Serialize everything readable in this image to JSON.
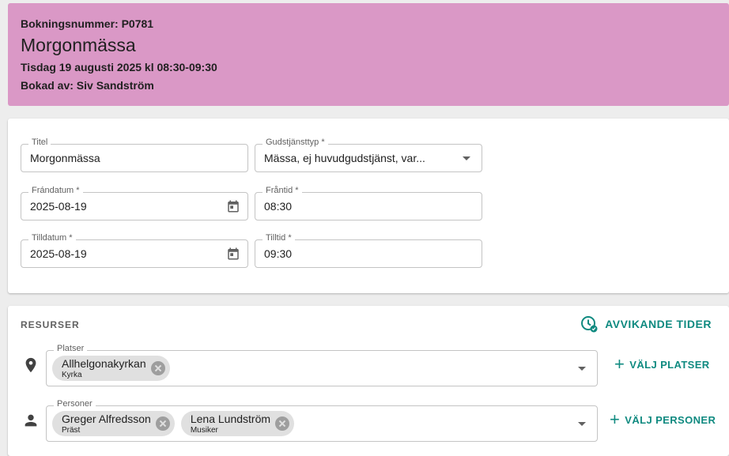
{
  "header": {
    "booking_number": "Bokningsnummer: P0781",
    "title": "Morgonmässa",
    "date": "Tisdag 19 augusti 2025 kl 08:30-09:30",
    "booked_by": "Bokad av: Siv Sandström",
    "background_color": "#da98c6"
  },
  "form": {
    "title": {
      "label": "Titel",
      "value": "Morgonmässa"
    },
    "service_type": {
      "label": "Gudstjänsttyp *",
      "value": "Mässa, ej huvudgudstjänst, var..."
    },
    "from_date": {
      "label": "Frándatum *",
      "value": "2025-08-19"
    },
    "from_time": {
      "label": "Fråntid *",
      "value": "08:30"
    },
    "to_date": {
      "label": "Tilldatum *",
      "value": "2025-08-19"
    },
    "to_time": {
      "label": "Tilltid *",
      "value": "09:30"
    }
  },
  "resources": {
    "heading": "RESURSER",
    "deviating_times_label": "AVVIKANDE TIDER",
    "accent_color": "#0f8a80",
    "places": {
      "label": "Platser",
      "icon": "location-pin-icon",
      "chips": [
        {
          "name": "Allhelgonakyrkan",
          "sub": "Kyrka"
        }
      ],
      "pick_label": "VÄLJ PLATSER"
    },
    "persons": {
      "label": "Personer",
      "icon": "person-icon",
      "chips": [
        {
          "name": "Greger Alfredsson",
          "sub": "Präst"
        },
        {
          "name": "Lena Lundström",
          "sub": "Musiker"
        }
      ],
      "pick_label": "VÄLJ PERSONER"
    }
  }
}
